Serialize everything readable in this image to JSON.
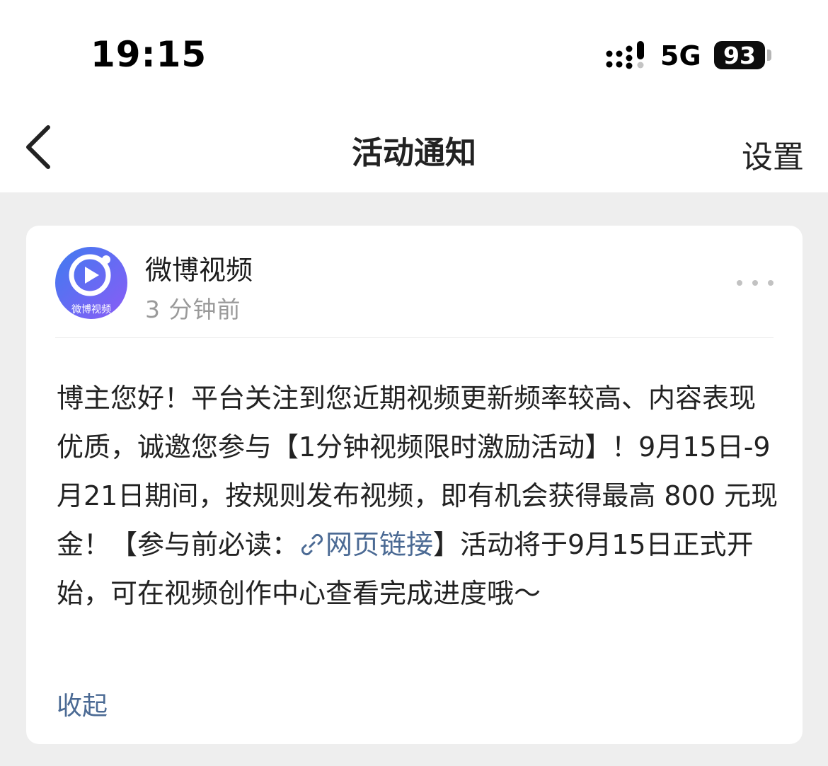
{
  "status_bar": {
    "time": "19:15",
    "network": "5G",
    "battery": "93"
  },
  "nav": {
    "back_icon": "chevron-left-icon",
    "title": "活动通知",
    "settings_label": "设置"
  },
  "notification": {
    "avatar": {
      "icon": "weibo-video-logo",
      "caption": "微博视频",
      "colors": [
        "#3f7bf0",
        "#8b5cf6"
      ]
    },
    "sender": "微博视频",
    "time_ago": "3 分钟前",
    "more_icon": "more-horizontal-icon",
    "message": {
      "before_link": "博主您好！平台关注到您近期视频更新频率较高、内容表现优质，诚邀您参与【1分钟视频限时激励活动】！9月15日-9月21日期间，按规则发布视频，即有机会获得最高 800 元现金！【参与前必读：",
      "link_icon": "link-icon",
      "link_text": "网页链接",
      "after_link": "】活动将于9月15日正式开始，可在视频创作中心查看完成进度哦～"
    },
    "collapse_label": "收起"
  },
  "colors": {
    "link": "#4b6a94",
    "background": "#eeeeee",
    "card": "#ffffff"
  }
}
